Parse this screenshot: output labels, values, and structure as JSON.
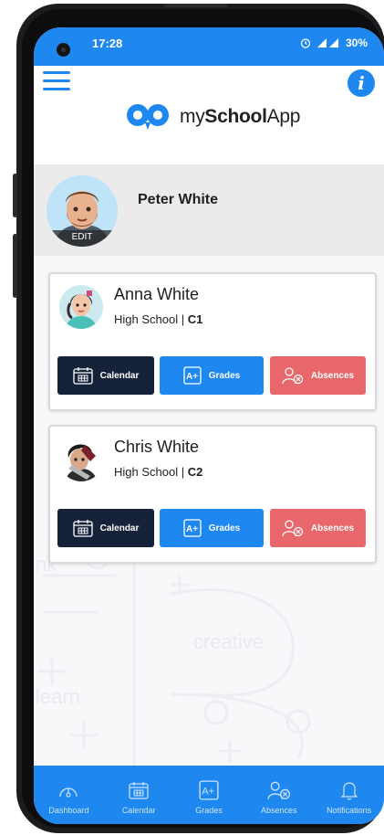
{
  "status_bar": {
    "time": "17:28",
    "battery": "30%"
  },
  "app": {
    "logo_prefix": "my",
    "logo_bold": "School",
    "logo_suffix": "App"
  },
  "profile": {
    "name": "Peter White",
    "edit_label": "EDIT"
  },
  "children": [
    {
      "name": "Anna White",
      "school": "High School | ",
      "class": "C1",
      "buttons": {
        "calendar": "Calendar",
        "grades": "Grades",
        "absences": "Absences"
      }
    },
    {
      "name": "Chris White",
      "school": "High School | ",
      "class": "C2",
      "buttons": {
        "calendar": "Calendar",
        "grades": "Grades",
        "absences": "Absences"
      }
    }
  ],
  "background_words": [
    "nk",
    "creative",
    "learn"
  ],
  "tabs": [
    {
      "label": "Dashboard",
      "icon": "gauge-icon"
    },
    {
      "label": "Calendar",
      "icon": "calendar-icon"
    },
    {
      "label": "Grades",
      "icon": "grades-icon"
    },
    {
      "label": "Absences",
      "icon": "absences-icon"
    },
    {
      "label": "Notifications",
      "icon": "bell-icon"
    }
  ],
  "colors": {
    "primary": "#1e88f0",
    "dark": "#16213a",
    "danger": "#e8676a"
  }
}
